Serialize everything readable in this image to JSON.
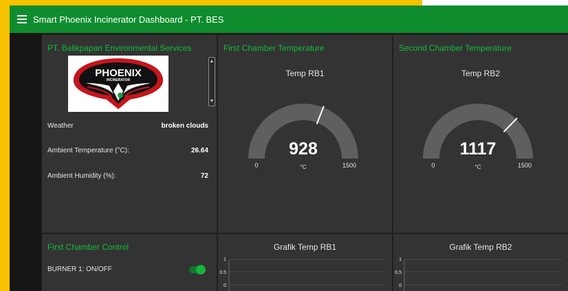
{
  "header": {
    "title": "Smart Phoenix Incinerator Dashboard - PT. BES"
  },
  "info_card": {
    "title": "PT. Balikpapan Environmental Services",
    "logo": {
      "text": "PHOENIX",
      "subtext": "INCINERATOR"
    },
    "rows": [
      {
        "label": "Weather",
        "value": "broken clouds"
      },
      {
        "label": "Ambient Temperature (°C):",
        "value": "26.64"
      },
      {
        "label": "Ambient Humidity (%):",
        "value": "72"
      }
    ]
  },
  "control_card": {
    "title": "First Chamber Control",
    "controls": [
      {
        "label": "BURNER 1: ON/OFF",
        "on": true
      }
    ]
  },
  "chamber1": {
    "title": "First Chamber Temperature",
    "gauge_label": "Temp RB1",
    "value": "928",
    "unit": "°C",
    "min": "0",
    "max": "1500",
    "chart_title": "Grafik Temp RB1",
    "chart_ticks": [
      "1",
      "0.5",
      "0"
    ]
  },
  "chamber2": {
    "title": "Second Chamber Temperature",
    "gauge_label": "Temp RB2",
    "value": "1117",
    "unit": "°C",
    "min": "0",
    "max": "1500",
    "chart_title": "Grafik Temp RB2",
    "chart_ticks": [
      "1",
      "0.5",
      "0"
    ]
  },
  "colors": {
    "accent_green": "#0fbf39",
    "header_green": "#0f8d2e",
    "gauge_track": "#5f5f5f",
    "needle": "#ffffff",
    "card": "#333333"
  }
}
